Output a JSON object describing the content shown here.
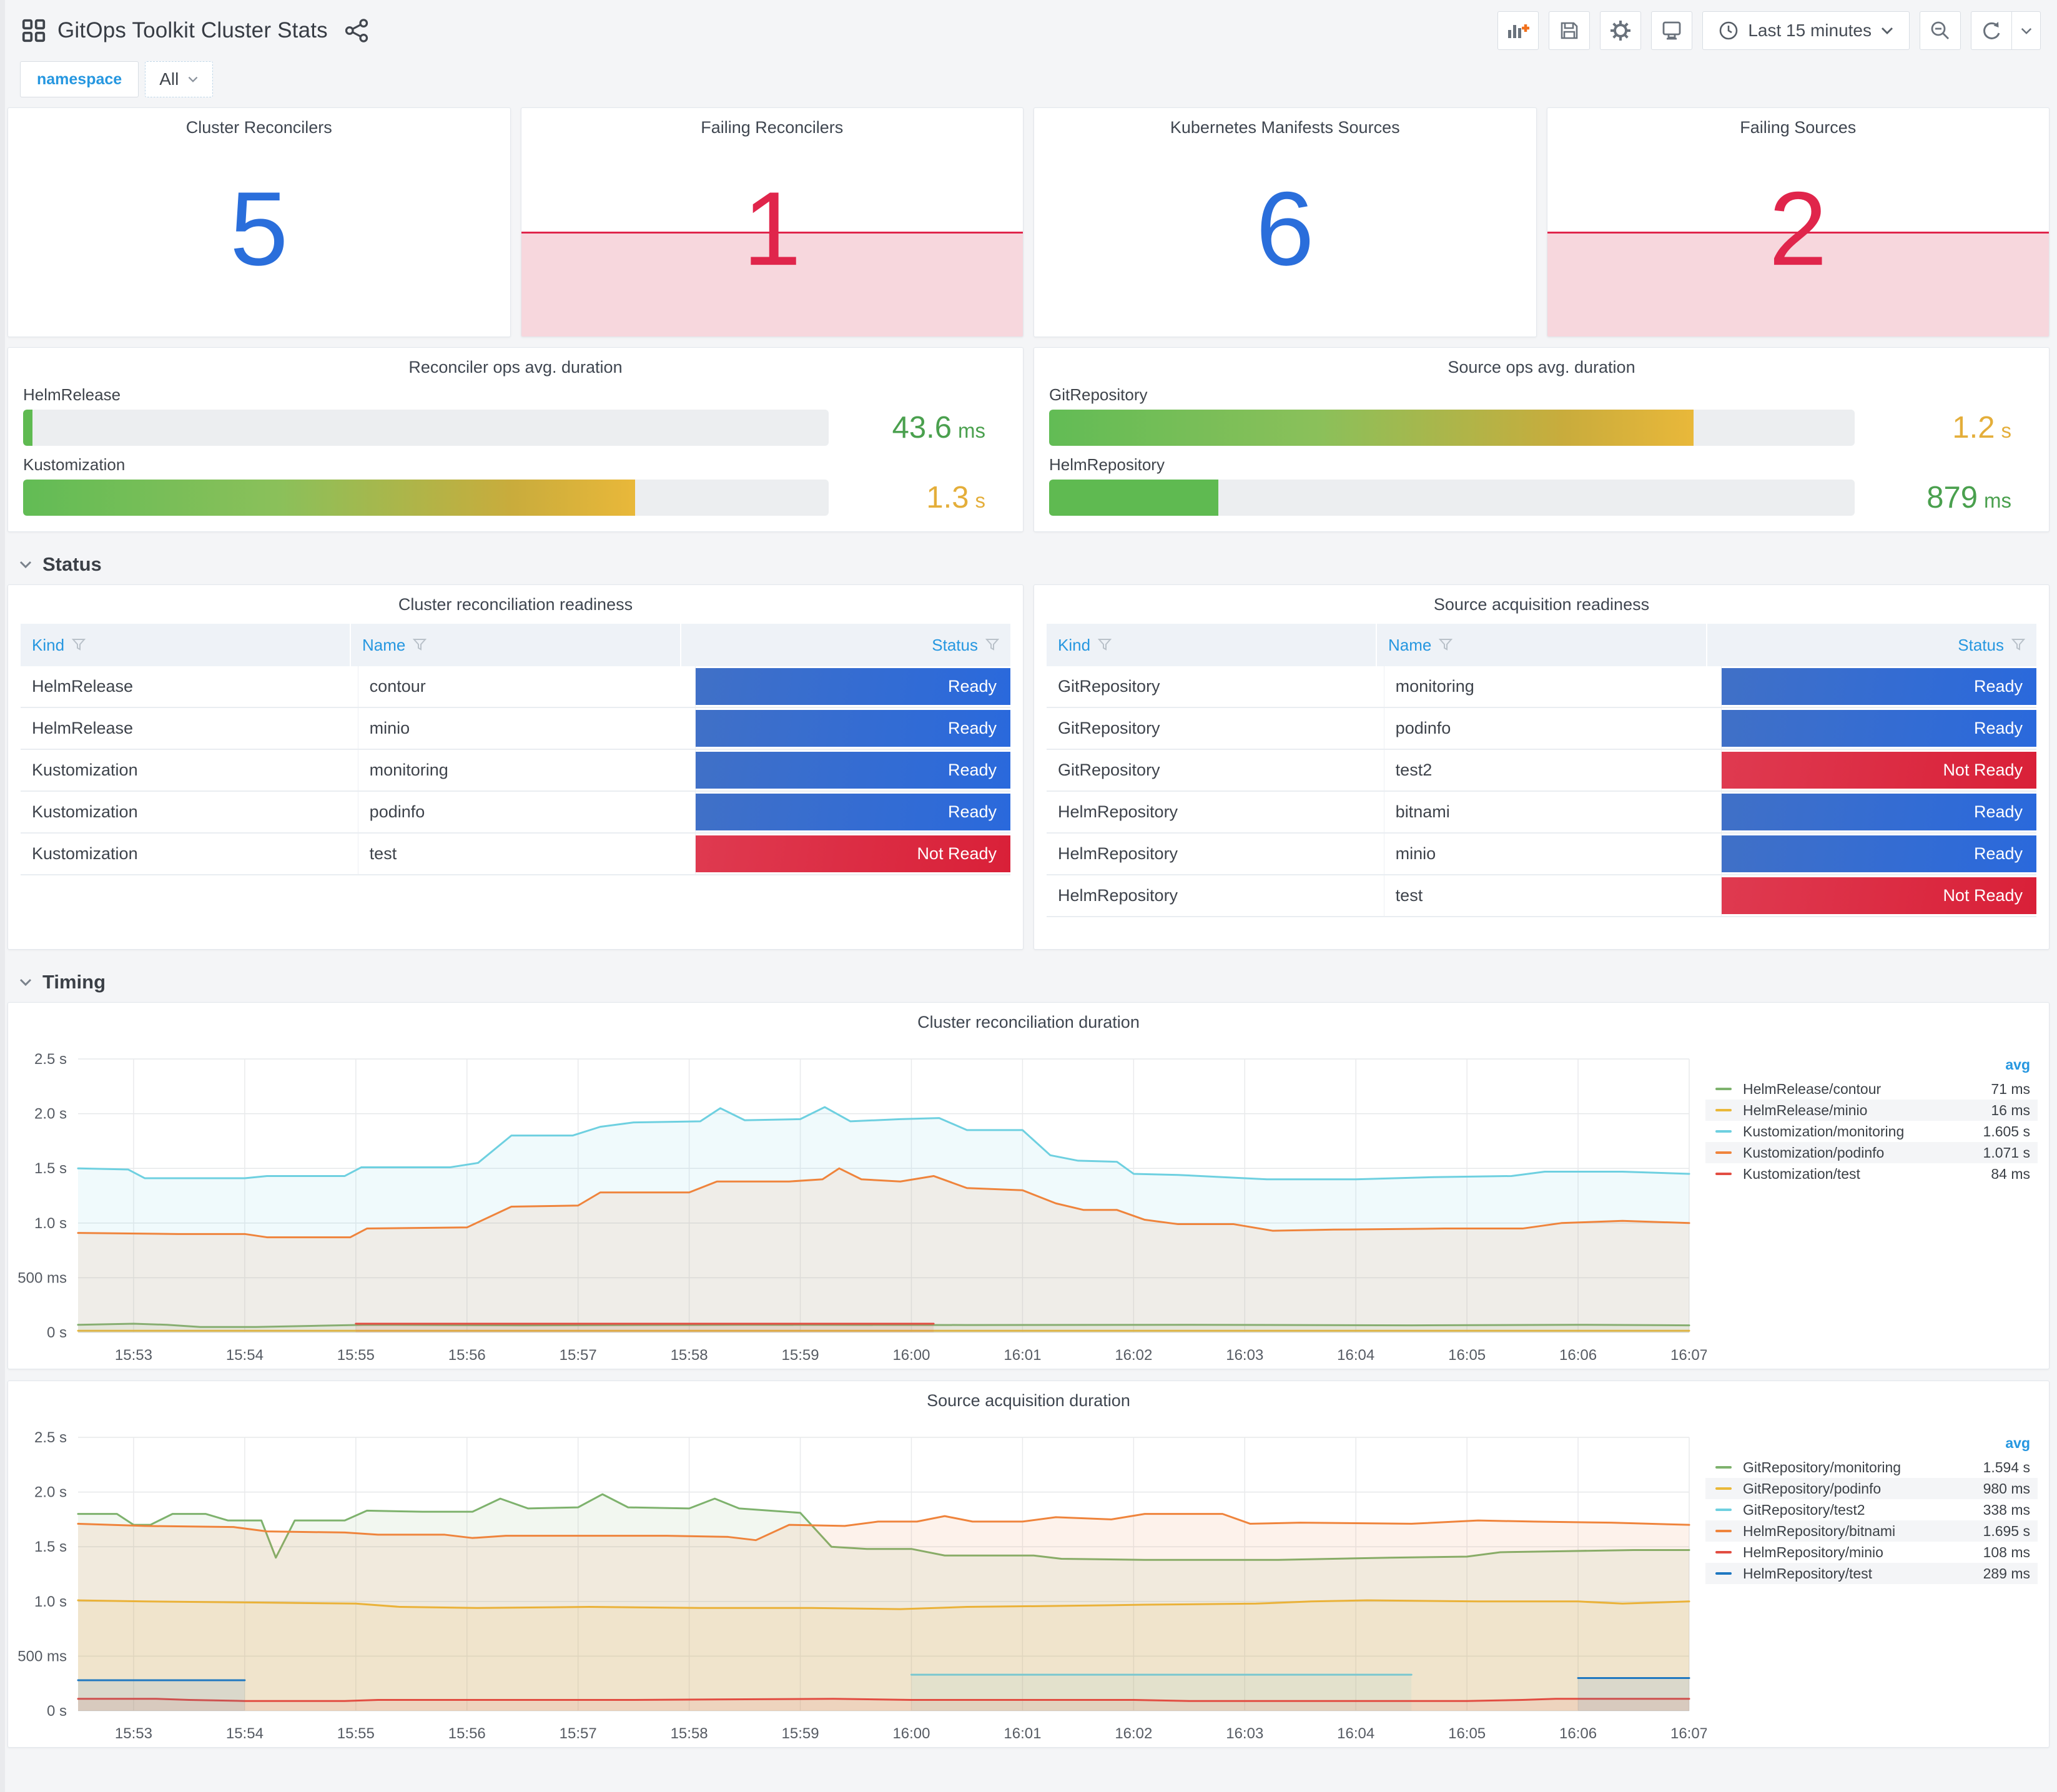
{
  "header": {
    "title": "GitOps Toolkit Cluster Stats"
  },
  "toolbar": {
    "time_range": "Last 15 minutes"
  },
  "variables": {
    "label": "namespace",
    "value": "All"
  },
  "sections": {
    "status": "Status",
    "timing": "Timing"
  },
  "colors": {
    "stat_ok": "#2A6EDB",
    "stat_alert": "#E0254B",
    "link_blue": "#2697E0",
    "ready_blue": "#2A69DC",
    "not_ready_red": "#D92038",
    "value_green": "#4AA04E",
    "value_amber": "#E4AE3A"
  },
  "stats": [
    {
      "title": "Cluster Reconcilers",
      "value": "5",
      "state": "ok"
    },
    {
      "title": "Failing Reconcilers",
      "value": "1",
      "state": "alert"
    },
    {
      "title": "Kubernetes Manifests Sources",
      "value": "6",
      "state": "ok"
    },
    {
      "title": "Failing Sources",
      "value": "2",
      "state": "alert"
    }
  ],
  "gauges": [
    {
      "title": "Reconciler ops avg. duration",
      "rows": [
        {
          "label": "HelmRelease",
          "value": "43.6",
          "unit": "ms",
          "value_color": "#4AA04E",
          "percent": 1.2,
          "bar": "green"
        },
        {
          "label": "Kustomization",
          "value": "1.3",
          "unit": "s",
          "value_color": "#E4AE3A",
          "percent": 76,
          "bar": "gradient"
        }
      ]
    },
    {
      "title": "Source ops avg. duration",
      "rows": [
        {
          "label": "GitRepository",
          "value": "1.2",
          "unit": "s",
          "value_color": "#E4AE3A",
          "percent": 80,
          "bar": "gradient"
        },
        {
          "label": "HelmRepository",
          "value": "879",
          "unit": "ms",
          "value_color": "#4AA04E",
          "percent": 21,
          "bar": "green"
        }
      ]
    }
  ],
  "tables": [
    {
      "title": "Cluster reconciliation readiness",
      "columns": [
        "Kind",
        "Name",
        "Status"
      ],
      "rows": [
        [
          "HelmRelease",
          "contour",
          "Ready"
        ],
        [
          "HelmRelease",
          "minio",
          "Ready"
        ],
        [
          "Kustomization",
          "monitoring",
          "Ready"
        ],
        [
          "Kustomization",
          "podinfo",
          "Ready"
        ],
        [
          "Kustomization",
          "test",
          "Not Ready"
        ]
      ]
    },
    {
      "title": "Source acquisition readiness",
      "columns": [
        "Kind",
        "Name",
        "Status"
      ],
      "rows": [
        [
          "GitRepository",
          "monitoring",
          "Ready"
        ],
        [
          "GitRepository",
          "podinfo",
          "Ready"
        ],
        [
          "GitRepository",
          "test2",
          "Not Ready"
        ],
        [
          "HelmRepository",
          "bitnami",
          "Ready"
        ],
        [
          "HelmRepository",
          "minio",
          "Ready"
        ],
        [
          "HelmRepository",
          "test",
          "Not Ready"
        ]
      ]
    }
  ],
  "chart_data": [
    {
      "type": "line",
      "title": "Cluster reconciliation duration",
      "legend_header": "avg",
      "legend_position": "right",
      "grid": true,
      "x_start_label": "15:52:30",
      "x_range_minutes": 14.5,
      "ylim": [
        0,
        2.5
      ],
      "y_ticks": [
        "0 s",
        "500 ms",
        "1.0 s",
        "1.5 s",
        "2.0 s",
        "2.5 s"
      ],
      "x_ticks": [
        "15:53",
        "15:54",
        "15:55",
        "15:56",
        "15:57",
        "15:58",
        "15:59",
        "16:00",
        "16:01",
        "16:02",
        "16:03",
        "16:04",
        "16:05",
        "16:06",
        "16:07"
      ],
      "series": [
        {
          "name": "HelmRelease/contour",
          "color": "#7EB26D",
          "avg": "71 ms",
          "points": [
            [
              0,
              0.07
            ],
            [
              0.5,
              0.08
            ],
            [
              0.8,
              0.07
            ],
            [
              1.1,
              0.05
            ],
            [
              1.6,
              0.05
            ],
            [
              2.1,
              0.06
            ],
            [
              2.6,
              0.07
            ],
            [
              4.0,
              0.065
            ],
            [
              6.0,
              0.07
            ],
            [
              8.0,
              0.068
            ],
            [
              10.0,
              0.07
            ],
            [
              12.0,
              0.065
            ],
            [
              13.5,
              0.07
            ],
            [
              14.5,
              0.065
            ]
          ]
        },
        {
          "name": "HelmRelease/minio",
          "color": "#EAB839",
          "avg": "16 ms",
          "points": [
            [
              0,
              0.016
            ],
            [
              14.5,
              0.016
            ]
          ]
        },
        {
          "name": "Kustomization/monitoring",
          "color": "#6ED0E0",
          "avg": "1.605 s",
          "points": [
            [
              0,
              1.5
            ],
            [
              0.45,
              1.49
            ],
            [
              0.6,
              1.41
            ],
            [
              1.5,
              1.41
            ],
            [
              1.7,
              1.43
            ],
            [
              2.4,
              1.43
            ],
            [
              2.55,
              1.51
            ],
            [
              3.35,
              1.51
            ],
            [
              3.6,
              1.55
            ],
            [
              3.9,
              1.8
            ],
            [
              4.45,
              1.8
            ],
            [
              4.7,
              1.88
            ],
            [
              5.0,
              1.92
            ],
            [
              5.6,
              1.93
            ],
            [
              5.78,
              2.05
            ],
            [
              6.0,
              1.94
            ],
            [
              6.5,
              1.95
            ],
            [
              6.72,
              2.06
            ],
            [
              6.95,
              1.93
            ],
            [
              7.4,
              1.95
            ],
            [
              7.75,
              1.96
            ],
            [
              8.0,
              1.85
            ],
            [
              8.5,
              1.85
            ],
            [
              8.75,
              1.62
            ],
            [
              9.0,
              1.57
            ],
            [
              9.35,
              1.56
            ],
            [
              9.5,
              1.45
            ],
            [
              9.9,
              1.44
            ],
            [
              10.3,
              1.42
            ],
            [
              10.7,
              1.4
            ],
            [
              11.5,
              1.4
            ],
            [
              12.2,
              1.42
            ],
            [
              12.9,
              1.43
            ],
            [
              13.2,
              1.47
            ],
            [
              13.9,
              1.47
            ],
            [
              14.5,
              1.45
            ]
          ]
        },
        {
          "name": "Kustomization/podinfo",
          "color": "#EF843C",
          "avg": "1.071 s",
          "points": [
            [
              0,
              0.91
            ],
            [
              0.9,
              0.9
            ],
            [
              1.5,
              0.9
            ],
            [
              1.7,
              0.87
            ],
            [
              2.45,
              0.87
            ],
            [
              2.6,
              0.95
            ],
            [
              3.5,
              0.96
            ],
            [
              3.9,
              1.15
            ],
            [
              4.5,
              1.16
            ],
            [
              4.7,
              1.28
            ],
            [
              5.5,
              1.28
            ],
            [
              5.75,
              1.38
            ],
            [
              6.4,
              1.38
            ],
            [
              6.7,
              1.4
            ],
            [
              6.85,
              1.5
            ],
            [
              7.05,
              1.4
            ],
            [
              7.4,
              1.38
            ],
            [
              7.7,
              1.43
            ],
            [
              8.0,
              1.32
            ],
            [
              8.5,
              1.3
            ],
            [
              8.8,
              1.18
            ],
            [
              9.05,
              1.12
            ],
            [
              9.35,
              1.12
            ],
            [
              9.6,
              1.03
            ],
            [
              9.9,
              0.99
            ],
            [
              10.4,
              0.99
            ],
            [
              10.75,
              0.93
            ],
            [
              11.3,
              0.94
            ],
            [
              12.3,
              0.95
            ],
            [
              13.0,
              0.95
            ],
            [
              13.35,
              1.0
            ],
            [
              13.9,
              1.02
            ],
            [
              14.5,
              1.0
            ]
          ]
        },
        {
          "name": "Kustomization/test",
          "color": "#E24D42",
          "avg": "84 ms",
          "points": [
            [
              2.5,
              0.08
            ],
            [
              7.7,
              0.08
            ]
          ]
        }
      ]
    },
    {
      "type": "line",
      "title": "Source acquisition duration",
      "legend_header": "avg",
      "legend_position": "right",
      "grid": true,
      "x_start_label": "15:52:30",
      "x_range_minutes": 14.5,
      "ylim": [
        0,
        2.5
      ],
      "y_ticks": [
        "0 s",
        "500 ms",
        "1.0 s",
        "1.5 s",
        "2.0 s",
        "2.5 s"
      ],
      "x_ticks": [
        "15:53",
        "15:54",
        "15:55",
        "15:56",
        "15:57",
        "15:58",
        "15:59",
        "16:00",
        "16:01",
        "16:02",
        "16:03",
        "16:04",
        "16:05",
        "16:06",
        "16:07"
      ],
      "series": [
        {
          "name": "GitRepository/monitoring",
          "color": "#7EB26D",
          "avg": "1.594 s",
          "points": [
            [
              0,
              1.8
            ],
            [
              0.35,
              1.8
            ],
            [
              0.5,
              1.7
            ],
            [
              0.65,
              1.7
            ],
            [
              0.85,
              1.8
            ],
            [
              1.15,
              1.8
            ],
            [
              1.35,
              1.74
            ],
            [
              1.65,
              1.74
            ],
            [
              1.78,
              1.4
            ],
            [
              1.95,
              1.74
            ],
            [
              2.4,
              1.74
            ],
            [
              2.6,
              1.83
            ],
            [
              3.1,
              1.82
            ],
            [
              3.55,
              1.82
            ],
            [
              3.8,
              1.94
            ],
            [
              4.05,
              1.85
            ],
            [
              4.5,
              1.86
            ],
            [
              4.72,
              1.98
            ],
            [
              4.95,
              1.86
            ],
            [
              5.5,
              1.85
            ],
            [
              5.73,
              1.94
            ],
            [
              5.95,
              1.85
            ],
            [
              6.5,
              1.81
            ],
            [
              6.78,
              1.5
            ],
            [
              7.1,
              1.48
            ],
            [
              7.5,
              1.48
            ],
            [
              7.8,
              1.42
            ],
            [
              8.6,
              1.42
            ],
            [
              8.85,
              1.39
            ],
            [
              9.6,
              1.38
            ],
            [
              10.8,
              1.38
            ],
            [
              11.8,
              1.4
            ],
            [
              12.5,
              1.41
            ],
            [
              12.8,
              1.45
            ],
            [
              13.4,
              1.46
            ],
            [
              14.0,
              1.47
            ],
            [
              14.5,
              1.47
            ]
          ]
        },
        {
          "name": "GitRepository/podinfo",
          "color": "#EAB839",
          "avg": "980 ms",
          "points": [
            [
              0,
              1.01
            ],
            [
              0.6,
              1.0
            ],
            [
              1.6,
              0.99
            ],
            [
              2.5,
              0.98
            ],
            [
              2.9,
              0.95
            ],
            [
              3.6,
              0.94
            ],
            [
              4.6,
              0.95
            ],
            [
              5.6,
              0.94
            ],
            [
              6.6,
              0.94
            ],
            [
              7.4,
              0.93
            ],
            [
              8.0,
              0.95
            ],
            [
              8.9,
              0.96
            ],
            [
              9.6,
              0.97
            ],
            [
              10.6,
              0.98
            ],
            [
              11.1,
              1.0
            ],
            [
              11.6,
              1.01
            ],
            [
              12.6,
              1.0
            ],
            [
              13.5,
              1.0
            ],
            [
              13.9,
              0.98
            ],
            [
              14.5,
              1.0
            ]
          ]
        },
        {
          "name": "GitRepository/test2",
          "color": "#6ED0E0",
          "avg": "338 ms",
          "segments": [
            [
              [
                7.5,
                0.33
              ],
              [
                12.0,
                0.33
              ]
            ]
          ]
        },
        {
          "name": "HelmRepository/bitnami",
          "color": "#EF843C",
          "avg": "1.695 s",
          "points": [
            [
              0,
              1.71
            ],
            [
              0.6,
              1.69
            ],
            [
              1.4,
              1.68
            ],
            [
              1.7,
              1.64
            ],
            [
              2.4,
              1.63
            ],
            [
              2.7,
              1.61
            ],
            [
              3.3,
              1.61
            ],
            [
              3.55,
              1.58
            ],
            [
              3.85,
              1.6
            ],
            [
              5.3,
              1.6
            ],
            [
              5.85,
              1.59
            ],
            [
              6.1,
              1.56
            ],
            [
              6.4,
              1.7
            ],
            [
              6.9,
              1.69
            ],
            [
              7.2,
              1.73
            ],
            [
              7.55,
              1.73
            ],
            [
              7.8,
              1.78
            ],
            [
              8.05,
              1.73
            ],
            [
              8.5,
              1.73
            ],
            [
              8.8,
              1.77
            ],
            [
              9.3,
              1.75
            ],
            [
              9.6,
              1.8
            ],
            [
              10.3,
              1.8
            ],
            [
              10.55,
              1.71
            ],
            [
              11.0,
              1.72
            ],
            [
              12.0,
              1.71
            ],
            [
              12.6,
              1.74
            ],
            [
              13.1,
              1.73
            ],
            [
              13.8,
              1.72
            ],
            [
              14.5,
              1.7
            ]
          ]
        },
        {
          "name": "HelmRepository/minio",
          "color": "#E24D42",
          "avg": "108 ms",
          "points": [
            [
              0,
              0.11
            ],
            [
              0.7,
              0.11
            ],
            [
              1.0,
              0.1
            ],
            [
              1.5,
              0.09
            ],
            [
              2.4,
              0.09
            ],
            [
              2.7,
              0.1
            ],
            [
              5.0,
              0.1
            ],
            [
              6.8,
              0.11
            ],
            [
              7.5,
              0.1
            ],
            [
              9.5,
              0.1
            ],
            [
              10.0,
              0.09
            ],
            [
              12.5,
              0.09
            ],
            [
              13.0,
              0.1
            ],
            [
              13.3,
              0.11
            ],
            [
              14.5,
              0.11
            ]
          ]
        },
        {
          "name": "HelmRepository/test",
          "color": "#1F78C1",
          "avg": "289 ms",
          "segments": [
            [
              [
                0,
                0.28
              ],
              [
                1.5,
                0.28
              ]
            ],
            [
              [
                13.5,
                0.3
              ],
              [
                14.5,
                0.3
              ]
            ]
          ]
        }
      ]
    }
  ]
}
